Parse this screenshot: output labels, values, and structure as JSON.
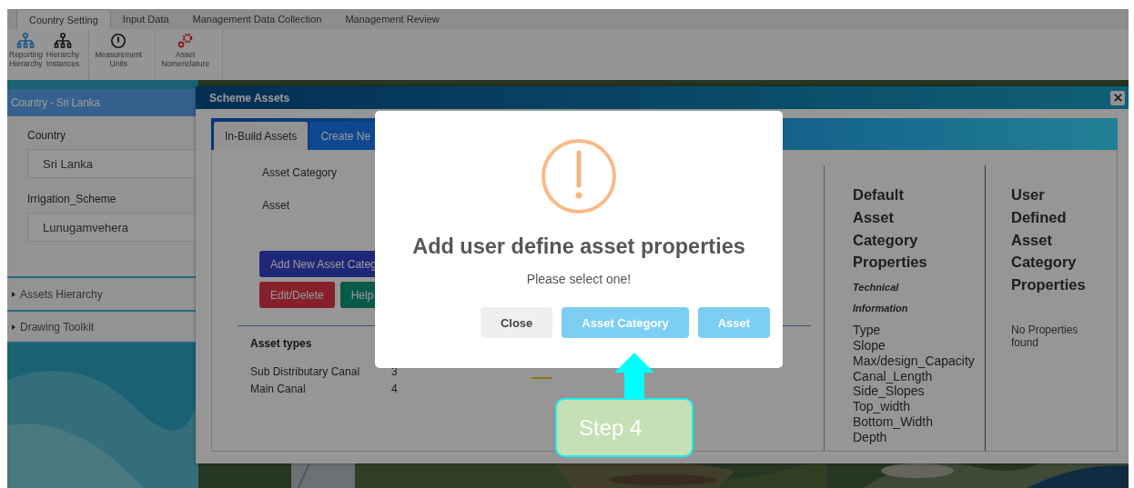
{
  "ribbon": {
    "tabs": [
      {
        "label": "Country Setting",
        "selected": true
      },
      {
        "label": "Input Data",
        "selected": false
      },
      {
        "label": "Management Data Collection",
        "selected": false
      },
      {
        "label": "Management Review",
        "selected": false
      }
    ],
    "tool_groups": [
      [
        {
          "kind": "reporting",
          "label": "Reporting Hierarchy"
        },
        {
          "kind": "instances",
          "label": "Hierarchy Instances"
        }
      ],
      [
        {
          "kind": "units",
          "label": "Measurement Units"
        }
      ],
      [
        {
          "kind": "nomenclature",
          "label": "Asset Nomenclature"
        }
      ]
    ]
  },
  "sidebar": {
    "header": "Country - Sri Lanka",
    "fields": [
      {
        "label": "Country",
        "value": "Sri Lanka"
      },
      {
        "label": "Irrigation_Scheme",
        "value": "Lunugamvehera"
      }
    ],
    "sections": [
      {
        "label": "Assets Hierarchy",
        "expanded": false
      },
      {
        "label": "Drawing Toolkit",
        "expanded": false
      }
    ]
  },
  "modal": {
    "title": "Scheme Assets",
    "tabs": [
      {
        "label": "In-Build Assets",
        "selected": true
      },
      {
        "label": "Create Ne",
        "selected": false
      }
    ],
    "form_labels": [
      "Asset Category",
      "Asset"
    ],
    "buttons": [
      {
        "label": "Add New Asset Categ",
        "kind": "primary"
      },
      {
        "label": "Edit/Delete",
        "kind": "danger"
      },
      {
        "label": "Help",
        "kind": "success"
      }
    ],
    "asset_types": {
      "heading": "Asset types",
      "rows": [
        {
          "name": "Sub Distributary Canal",
          "count": "3"
        },
        {
          "name": "Main Canal",
          "count": "4"
        }
      ]
    },
    "default_props": {
      "heading": "Default Asset Category Properties",
      "subheading": "Technical Information",
      "items": [
        "Type",
        "Slope",
        "Max/design_Capacity",
        "Canal_Length",
        "Side_Slopes",
        "Top_width",
        "Bottom_Width",
        "Depth"
      ]
    },
    "user_props": {
      "heading": "User Defined Asset Category Properties",
      "empty": "No Properties found"
    }
  },
  "alert": {
    "title": "Add user define asset properties",
    "message": "Please select one!",
    "buttons": [
      {
        "label": "Close",
        "kind": "secondary"
      },
      {
        "label": "Asset Category",
        "kind": "confirm"
      },
      {
        "label": "Asset",
        "kind": "confirm"
      }
    ]
  },
  "callout": {
    "text": "Step 4"
  }
}
